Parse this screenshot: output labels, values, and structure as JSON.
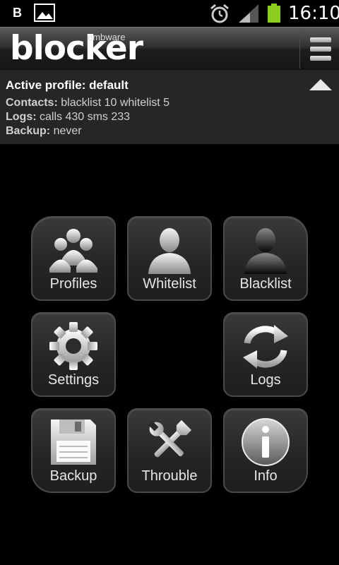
{
  "status_bar": {
    "left_label": "B",
    "time": "16:10",
    "icons": [
      "gallery-icon",
      "alarm-icon",
      "signal-icon",
      "battery-icon"
    ],
    "battery_color": "#8ccc1a"
  },
  "app_bar": {
    "logo": "blocker",
    "brand": "embware",
    "menu_icon": "menu-icon"
  },
  "profile": {
    "title": "Active profile: default",
    "contacts_label": "Contacts:",
    "contacts_value": "blacklist 10 whitelist 5",
    "logs_label": "Logs:",
    "logs_value": "calls 430 sms 233",
    "backup_label": "Backup:",
    "backup_value": "never"
  },
  "grid": {
    "profiles": "Profiles",
    "whitelist": "Whitelist",
    "blacklist": "Blacklist",
    "settings": "Settings",
    "logs": "Logs",
    "backup": "Backup",
    "trouble": "Throuble",
    "info": "Info"
  }
}
